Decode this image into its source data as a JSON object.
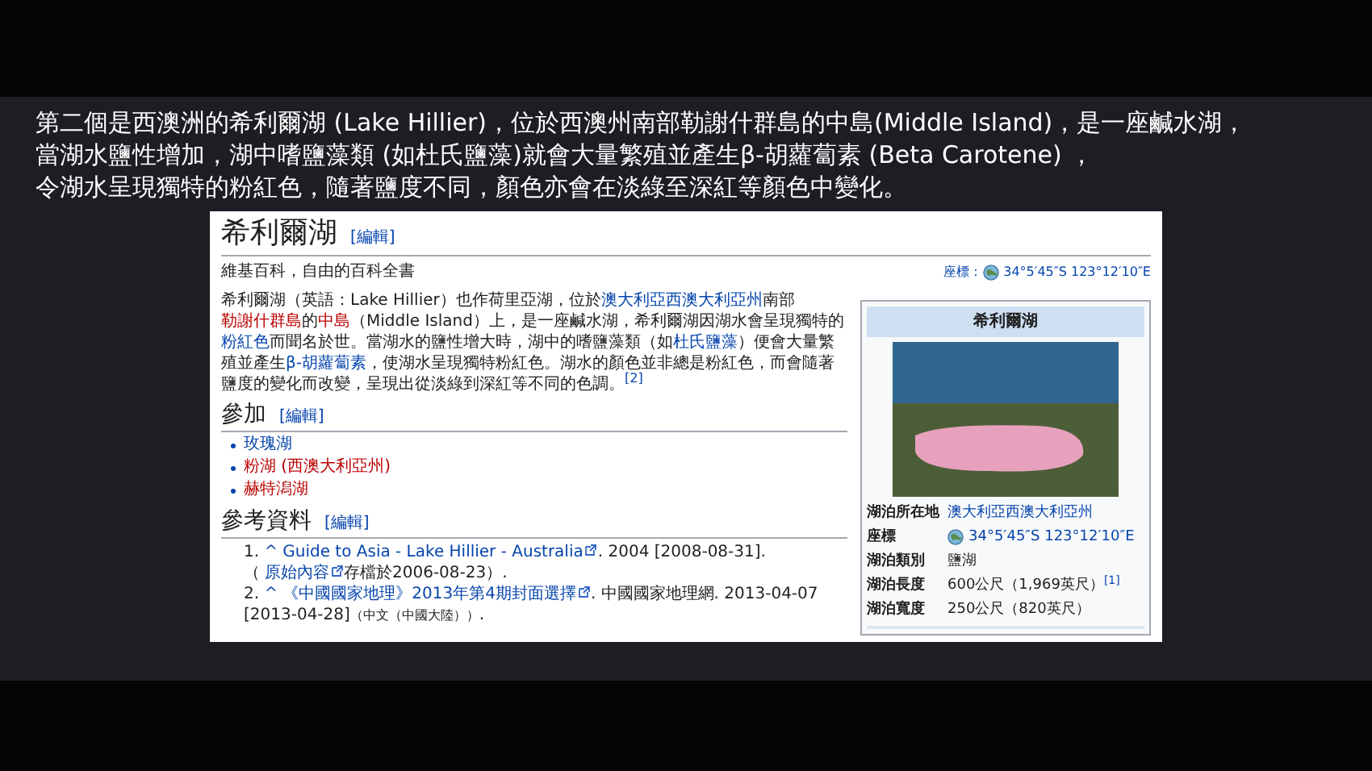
{
  "caption": {
    "lines": [
      "第二個是西澳洲的希利爾湖 (Lake Hillier)，位於西澳州南部勒謝什群島的中島(Middle Island)，是一座鹹水湖，",
      "當湖水鹽性增加，湖中嗜鹽藻類 (如杜氏鹽藻)就會大量繁殖並產生β-胡蘿蔔素 (Beta Carotene) ，",
      "令湖水呈現獨特的粉紅色，隨著鹽度不同，顏色亦會在淡綠至深紅等顏色中變化。"
    ]
  },
  "article": {
    "title": "希利爾湖",
    "edit_link": "[編輯]",
    "tagline": "維基百科，自由的百科全書",
    "coordinates": {
      "label": "座標：",
      "value": "34°5′45″S 123°12′10″E"
    },
    "paragraph": [
      {
        "kind": "plain",
        "text": "希利爾湖（英語：Lake Hillier）也作荷里亞湖，位於"
      },
      {
        "kind": "link",
        "text": "澳大利亞西澳大利亞州"
      },
      {
        "kind": "plain",
        "text": "南部"
      },
      {
        "kind": "redlink",
        "text": "勒謝什群島"
      },
      {
        "kind": "plain",
        "text": "的"
      },
      {
        "kind": "redlink",
        "text": "中島"
      },
      {
        "kind": "plain",
        "text": "（Middle Island）上，是一座鹹水湖，希利爾湖因湖水會呈現獨特的"
      },
      {
        "kind": "link",
        "text": "粉紅色"
      },
      {
        "kind": "plain",
        "text": "而聞名於世。當湖水的鹽性增大時，湖中的嗜鹽藻類（如"
      },
      {
        "kind": "link",
        "text": "杜氏鹽藻"
      },
      {
        "kind": "plain",
        "text": "）便會大量繁殖並產生"
      },
      {
        "kind": "link",
        "text": "β-胡蘿蔔素"
      },
      {
        "kind": "plain",
        "text": "，使湖水呈現獨特粉紅色。湖水的顏色並非總是粉紅色，而會隨著鹽度的變化而改變，呈現出從淡綠到深紅等不同的色調。"
      },
      {
        "kind": "sup",
        "text": "[2]"
      }
    ],
    "sections": [
      {
        "heading": "參加",
        "edit_link": "[編輯]",
        "items": [
          {
            "kind": "link",
            "text": "玫瑰湖"
          },
          {
            "kind": "redlink",
            "text": "粉湖 (西澳大利亞州)"
          },
          {
            "kind": "redlink",
            "text": "赫特潟湖"
          }
        ]
      }
    ],
    "references": {
      "heading": "參考資料",
      "edit_link": "[編輯]",
      "items": [
        [
          {
            "kind": "plain",
            "text": "1. "
          },
          {
            "kind": "link",
            "text": "^"
          },
          {
            "kind": "link",
            "text": "Guide to Asia - Lake Hillier - Australia",
            "external": true
          },
          {
            "kind": "plain",
            "text": ". 2004 [2008-08-31].（"
          },
          {
            "kind": "link",
            "text": "原始內容",
            "external": true
          },
          {
            "kind": "plain",
            "text": "存檔於2006-08-23）."
          }
        ],
        [
          {
            "kind": "plain",
            "text": "2. "
          },
          {
            "kind": "link",
            "text": "^"
          },
          {
            "kind": "link",
            "text": "《中國國家地理》2013年第4期封面選擇",
            "external": true
          },
          {
            "kind": "plain",
            "text": ". 中國國家地理網. 2013-04-07 [2013-04-28]"
          },
          {
            "kind": "small",
            "text": "（中文（中國大陸））"
          },
          {
            "kind": "plain",
            "text": "."
          }
        ]
      ]
    },
    "infobox": {
      "title": "希利爾湖",
      "rows": [
        {
          "label": "湖泊所在地",
          "value": "澳大利亞西澳大利亞州",
          "kind": "link"
        },
        {
          "label": "座標",
          "value": "34°5′45″S 123°12′10″E",
          "kind": "coord"
        },
        {
          "label": "湖泊類別",
          "value": "鹽湖",
          "kind": "plain"
        },
        {
          "label": "湖泊長度",
          "value": "600公尺（1,969英尺）",
          "kind": "plain",
          "note": "[1]"
        },
        {
          "label": "湖泊寬度",
          "value": "250公尺（820英尺）",
          "kind": "plain"
        }
      ]
    }
  }
}
